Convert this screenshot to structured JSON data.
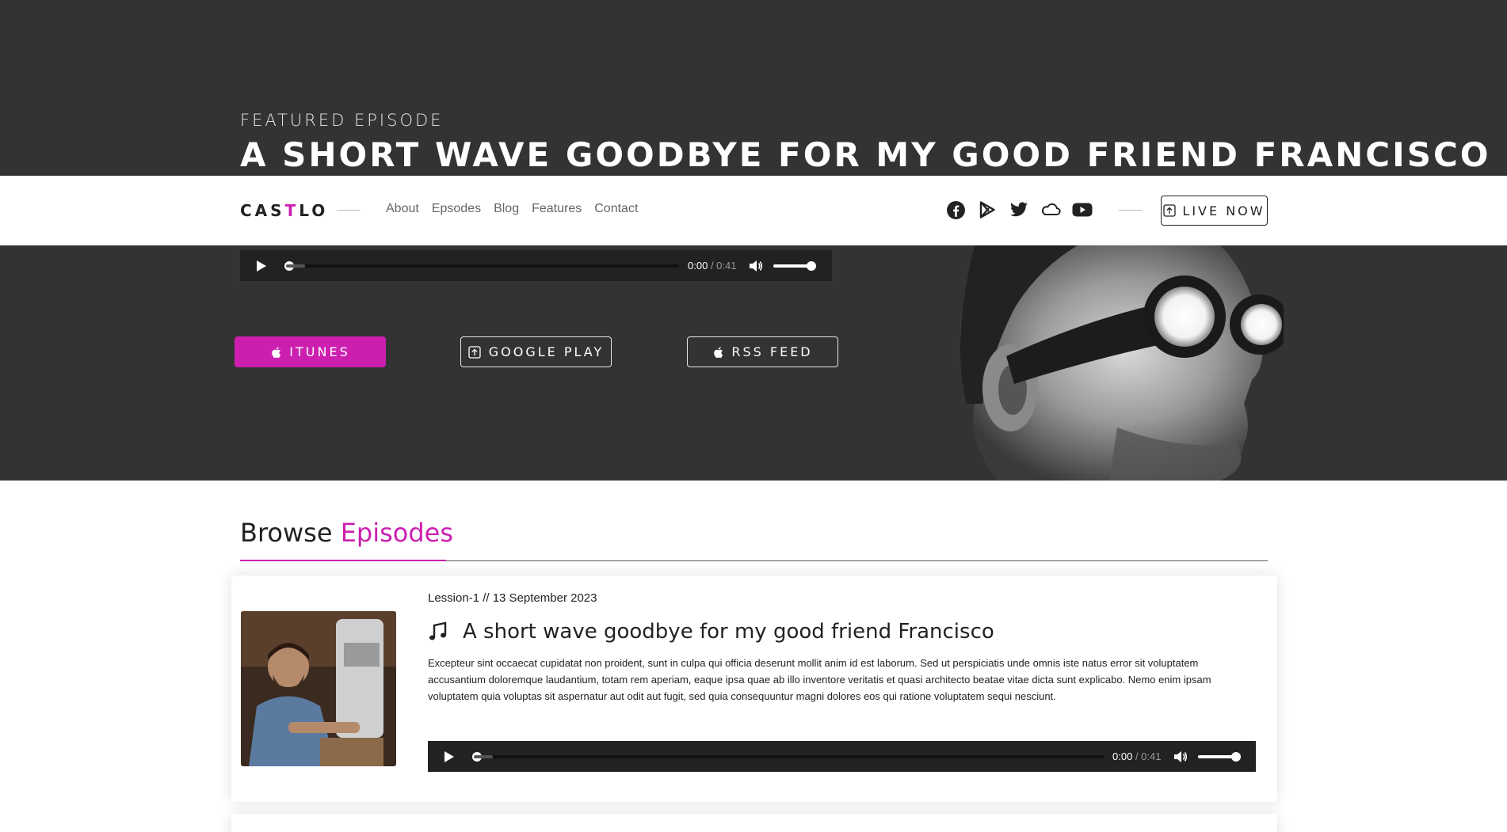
{
  "hero": {
    "eyebrow": "FEATURED EPISODE",
    "title": "A SHORT WAVE GOODBYE FOR MY GOOD FRIEND FRANCISCO"
  },
  "nav": {
    "logo_prefix": "CAS",
    "logo_accent": "T",
    "logo_suffix": "LO",
    "links": [
      "About",
      "Epsodes",
      "Blog",
      "Features",
      "Contact"
    ],
    "social_icons": [
      "facebook-icon",
      "google-play-icon",
      "twitter-icon",
      "soundcloud-icon",
      "youtube-icon"
    ],
    "live_label": "LIVE NOW"
  },
  "featured_player": {
    "current_time": "0:00",
    "duration": "/ 0:41",
    "progress": 0,
    "volume": 1
  },
  "store_buttons": [
    {
      "label": "ITUNES",
      "icon": "apple-icon"
    },
    {
      "label": "GOOGLE PLAY",
      "icon": "external-square-icon"
    },
    {
      "label": "RSS FEED",
      "icon": "apple-icon"
    }
  ],
  "browse": {
    "title_prefix": "Browse",
    "title_accent": "Episodes"
  },
  "episodes": [
    {
      "meta": "Lession-1 // 13 September 2023",
      "title": "A short wave goodbye for my good friend Francisco",
      "description": "Excepteur sint occaecat cupidatat non proident, sunt in culpa qui officia deserunt mollit anim id est laborum. Sed ut perspiciatis unde omnis iste natus error sit voluptatem accusantium doloremque laudantium, totam rem aperiam, eaque ipsa quae ab illo inventore veritatis et quasi architecto beatae vitae dicta sunt explicabo. Nemo enim ipsam voluptatem quia voluptas sit aspernatur aut odit aut fugit, sed quia consequuntur magni dolores eos qui ratione voluptatem sequi nesciunt.",
      "player": {
        "current_time": "0:00",
        "duration": "/ 0:41",
        "progress": 0,
        "volume": 1
      }
    }
  ],
  "colors": {
    "accent": "#cc1fb0",
    "dark_bg": "#333333",
    "player_bg": "#222222"
  }
}
